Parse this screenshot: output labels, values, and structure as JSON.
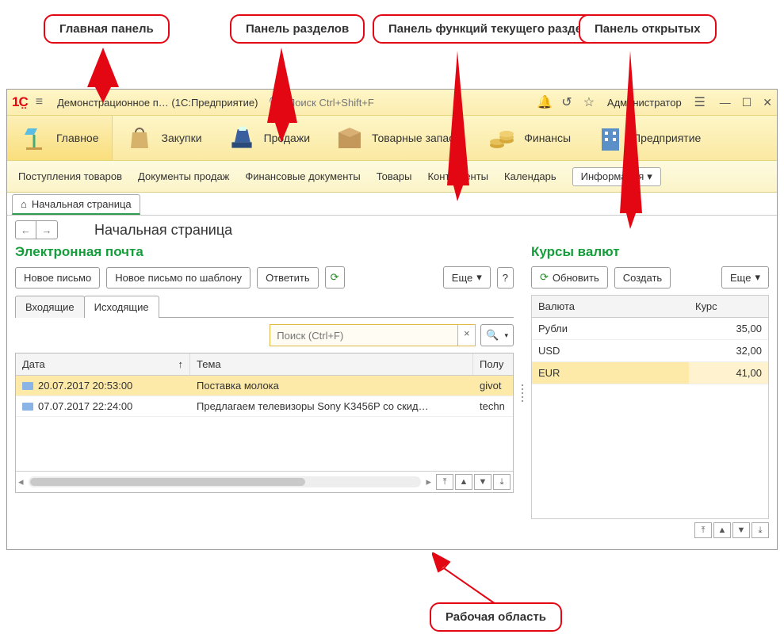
{
  "callouts": {
    "main_panel": "Главная панель",
    "sections_panel": "Панель разделов",
    "functions_panel": "Панель функций текущего раздела",
    "open_panel": "Панель открытых",
    "workspace": "Рабочая область"
  },
  "titlebar": {
    "app_title": "Демонстрационное п… (1С:Предприятие)",
    "search_placeholder": "Поиск Ctrl+Shift+F",
    "user": "Администратор"
  },
  "sections": {
    "main": "Главное",
    "purchases": "Закупки",
    "sales": "Продажи",
    "stock": "Товарные запасы",
    "finance": "Финансы",
    "enterprise": "Предприятие"
  },
  "functions": {
    "receipts": "Поступления товаров",
    "salesdocs": "Документы продаж",
    "findocs": "Финансовые документы",
    "goods": "Товары",
    "contragents": "Контрагенты",
    "calendar": "Календарь",
    "info": "Информация"
  },
  "opentab": {
    "home": "Начальная страница"
  },
  "page": {
    "title": "Начальная страница"
  },
  "email": {
    "title": "Электронная почта",
    "new": "Новое письмо",
    "new_tpl": "Новое письмо по шаблону",
    "reply": "Ответить",
    "more": "Еще",
    "help": "?",
    "tab_in": "Входящие",
    "tab_out": "Исходящие",
    "search_placeholder": "Поиск (Ctrl+F)",
    "col_date": "Дата",
    "col_subject": "Тема",
    "col_rcpt": "Полу",
    "rows": [
      {
        "date": "20.07.2017 20:53:00",
        "subject": "Поставка молока",
        "rcpt": "givot"
      },
      {
        "date": "07.07.2017 22:24:00",
        "subject": "Предлагаем телевизоры Sony K3456P со скид…",
        "rcpt": "techn"
      }
    ]
  },
  "rates": {
    "title": "Курсы валют",
    "refresh": "Обновить",
    "create": "Создать",
    "more": "Еще",
    "col_cur": "Валюта",
    "col_rate": "Курс",
    "rows": [
      {
        "cur": "Рубли",
        "rate": "35,00"
      },
      {
        "cur": "USD",
        "rate": "32,00"
      },
      {
        "cur": "EUR",
        "rate": "41,00"
      }
    ]
  }
}
